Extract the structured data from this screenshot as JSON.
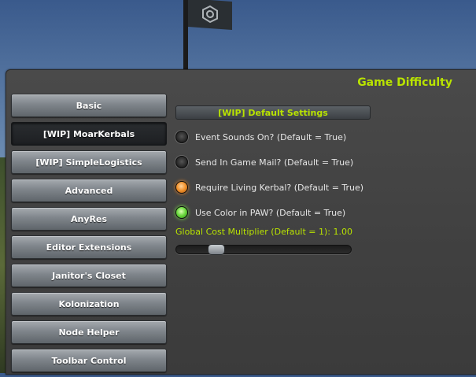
{
  "window": {
    "title": "Game Difficulty"
  },
  "sidebar": {
    "items": [
      {
        "label": "Basic",
        "active": false
      },
      {
        "label": "[WIP] MoarKerbals",
        "active": true
      },
      {
        "label": "[WIP] SimpleLogistics",
        "active": false
      },
      {
        "label": "Advanced",
        "active": false
      },
      {
        "label": "AnyRes",
        "active": false
      },
      {
        "label": "Editor Extensions",
        "active": false
      },
      {
        "label": "Janitor's Closet",
        "active": false
      },
      {
        "label": "Kolonization",
        "active": false
      },
      {
        "label": "Node Helper",
        "active": false
      },
      {
        "label": "Toolbar Control",
        "active": false
      }
    ]
  },
  "main": {
    "section_title": "[WIP] Default Settings",
    "toggles": [
      {
        "label": "Event Sounds On? (Default = True)",
        "state": "off"
      },
      {
        "label": "Send In Game Mail? (Default = True)",
        "state": "off"
      },
      {
        "label": "Require Living Kerbal? (Default = True)",
        "state": "hover"
      },
      {
        "label": "Use Color in PAW? (Default = True)",
        "state": "on"
      }
    ],
    "cost_multiplier_label": "Global Cost Multiplier (Default = 1): 1.00",
    "cost_multiplier_value": 1.0,
    "cost_multiplier_fraction": 0.2
  },
  "colors": {
    "accent_text": "#b9e300",
    "radio_on": "#66d63a",
    "radio_hover": "#f0902a"
  }
}
